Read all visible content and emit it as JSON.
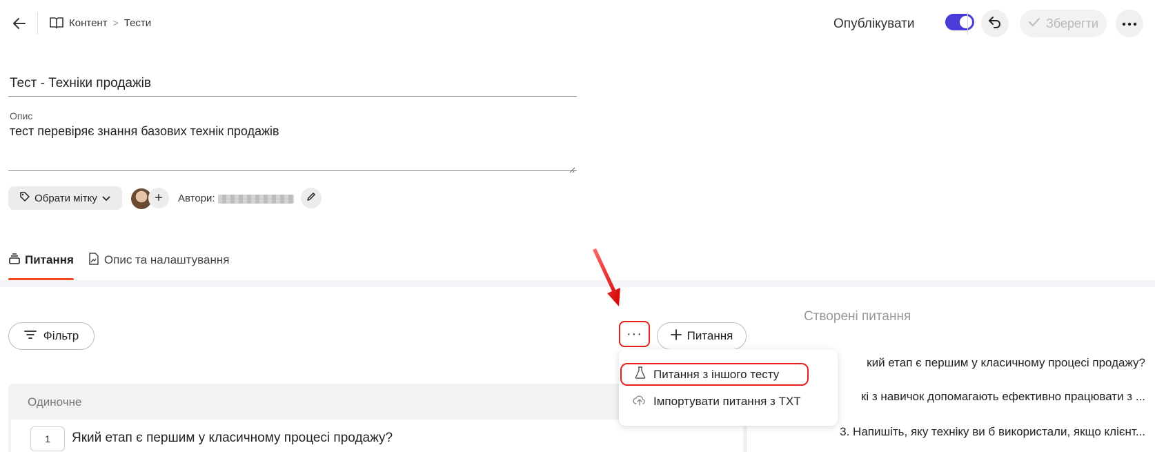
{
  "header": {
    "breadcrumb": [
      "Контент",
      "Тести"
    ],
    "publish_label": "Опублікувати",
    "publish_on": true,
    "save_label": "Зберегти"
  },
  "form": {
    "title_value": "Тест - Техніки продажів",
    "description_label": "Опис",
    "description_value": "тест перевіряє знання базових технік продажів",
    "tag_button": "Обрати мітку",
    "authors_label": "Автори:"
  },
  "tabs": [
    {
      "label": "Питання",
      "active": true
    },
    {
      "label": "Опис та налаштування",
      "active": false
    }
  ],
  "toolbar": {
    "filter_label": "Фільтр",
    "more_label": "···",
    "add_question_label": "Питання"
  },
  "dropdown": {
    "items": [
      "Питання з іншого тесту",
      "Імпортувати питання з TXT"
    ]
  },
  "questions": {
    "group_title": "Одиночне",
    "first_number": "1",
    "first_text": "Який етап є першим у класичному процесі продажу?"
  },
  "created_panel": {
    "title": "Створені питання",
    "items": [
      "кий етап є першим у класичному процесі продажу?",
      "кі з навичок допомагають ефективно працювати з ...",
      "3. Напишіть, яку техніку ви б використали, якщо клієнт..."
    ]
  },
  "colors": {
    "accent": "#4a3cd8",
    "tab_underline": "#ef4a24",
    "highlight": "#e8201c"
  }
}
